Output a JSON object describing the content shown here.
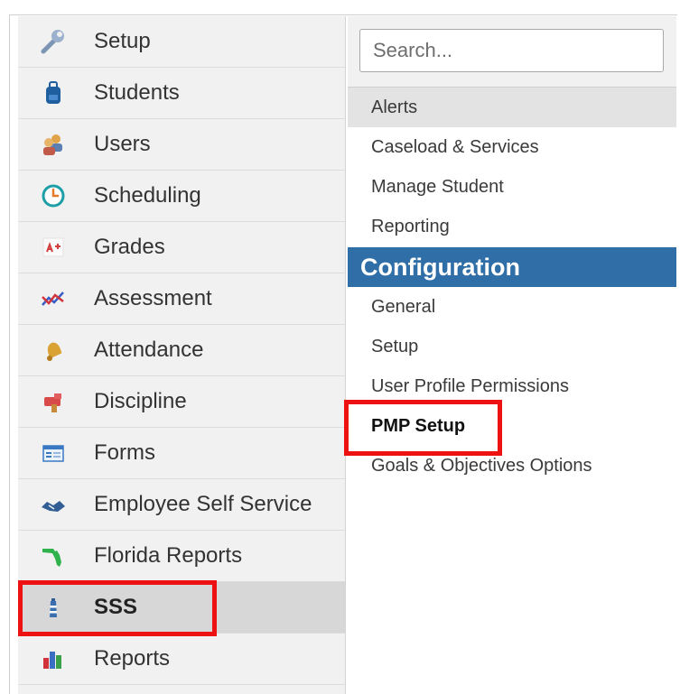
{
  "nav": {
    "items": [
      {
        "label": "Setup",
        "icon": "wrench-icon"
      },
      {
        "label": "Students",
        "icon": "backpack-icon"
      },
      {
        "label": "Users",
        "icon": "users-icon"
      },
      {
        "label": "Scheduling",
        "icon": "clock-icon"
      },
      {
        "label": "Grades",
        "icon": "grades-icon"
      },
      {
        "label": "Assessment",
        "icon": "assessment-chart-icon"
      },
      {
        "label": "Attendance",
        "icon": "bell-icon"
      },
      {
        "label": "Discipline",
        "icon": "flag-icon"
      },
      {
        "label": "Forms",
        "icon": "form-icon"
      },
      {
        "label": "Employee Self Service",
        "icon": "handshake-icon"
      },
      {
        "label": "Florida Reports",
        "icon": "florida-map-icon"
      },
      {
        "label": "SSS",
        "icon": "lighthouse-icon",
        "active": true
      },
      {
        "label": "Reports",
        "icon": "bar-chart-icon"
      }
    ]
  },
  "panel": {
    "search": {
      "placeholder": "Search..."
    },
    "items": {
      "alerts": "Alerts",
      "caseload": "Caseload & Services",
      "manage_student": "Manage Student",
      "reporting": "Reporting"
    },
    "config_header": "Configuration",
    "config_items": {
      "general": "General",
      "setup": "Setup",
      "user_profile_permissions": "User Profile Permissions",
      "pmp_setup": "PMP Setup",
      "goals_objectives": "Goals & Objectives Options"
    }
  },
  "colors": {
    "section_header_bg": "#2f6ea6",
    "highlight": "#ee1111",
    "nav_bg": "#f1f1f1",
    "nav_active_bg": "#d7d7d7"
  }
}
